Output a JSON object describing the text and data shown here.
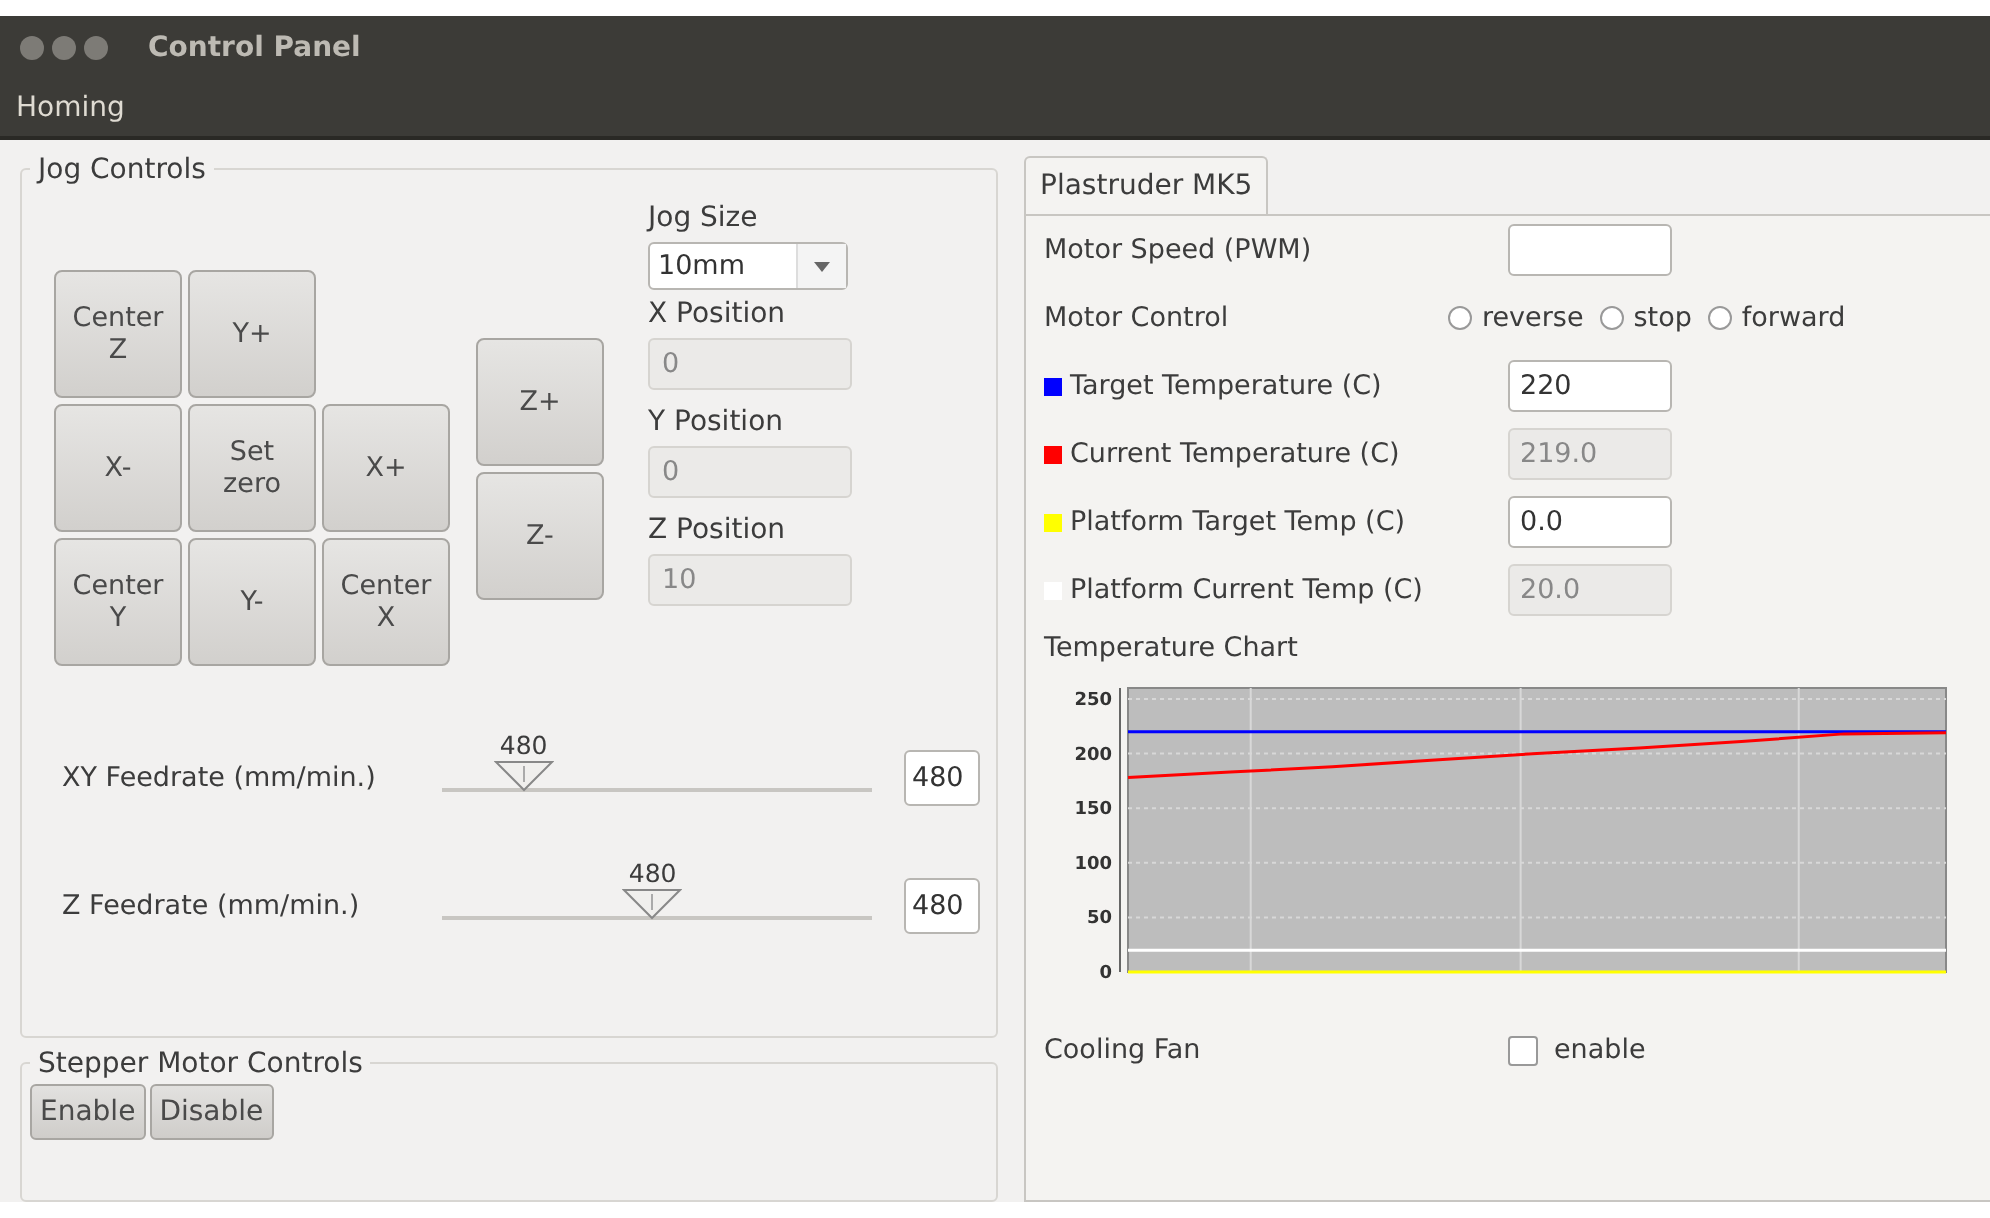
{
  "window": {
    "title": "Control Panel"
  },
  "menu": [
    "Homing"
  ],
  "jog_controls": {
    "title": "Jog Controls",
    "pad_rows": [
      {
        "buttons": [
          "Center Z",
          "Y+"
        ]
      },
      {
        "buttons": [
          "X-",
          "Set zero",
          "X+"
        ]
      },
      {
        "buttons": [
          "Center Y",
          "Y-",
          "Center X"
        ]
      }
    ],
    "z_buttons": [
      "Z+",
      "Z-"
    ],
    "jog_size": {
      "label": "Jog Size",
      "value": "10mm"
    },
    "positions": [
      {
        "label": "X Position",
        "value": "0"
      },
      {
        "label": "Y Position",
        "value": "0"
      },
      {
        "label": "Z Position",
        "value": "10"
      }
    ],
    "feedrates": [
      {
        "label": "XY Feedrate (mm/min.)",
        "reading": "480",
        "level": 0.19,
        "value": "480"
      },
      {
        "label": "Z Feedrate (mm/min.)",
        "reading": "480",
        "level": 0.49,
        "value": "480"
      }
    ]
  },
  "stepper": {
    "title": "Stepper Motor Controls",
    "buttons": [
      "Enable",
      "Disable"
    ]
  },
  "tabs": [
    {
      "label": "Plastruder MK5",
      "selected": true
    }
  ],
  "extruder": {
    "motor_speed": {
      "label": "Motor Speed (PWM)"
    },
    "motor_control": {
      "label": "Motor Control",
      "options": [
        {
          "label": "reverse",
          "selected": false
        },
        {
          "label": "stop",
          "selected": false
        },
        {
          "label": "forward",
          "selected": false
        }
      ]
    },
    "temps": [
      {
        "label": "Target Temperature (C)",
        "color": "#0000ff",
        "value": "220",
        "disabled": false
      },
      {
        "label": "Current Temperature (C)",
        "color": "#ff0000",
        "value": "219.0",
        "disabled": true
      },
      {
        "label": "Platform Target Temp (C)",
        "color": "#ffff00",
        "value": "0.0",
        "disabled": false
      },
      {
        "label": "Platform Current Temp (C)",
        "color": "#ffffff",
        "value": "20.0",
        "disabled": true
      }
    ],
    "chart_title": "Temperature Chart",
    "chart_data": {
      "type": "line",
      "grid": true,
      "ylim": [
        0,
        260
      ],
      "yticks": [
        0,
        50,
        100,
        150,
        200,
        250
      ],
      "series": [
        {
          "color": "#0000ff",
          "values": [
            220,
            220,
            220,
            220,
            220,
            220,
            220,
            220,
            220
          ]
        },
        {
          "color": "#ff0000",
          "values": [
            178,
            183,
            188,
            194,
            200,
            205,
            211,
            218,
            219
          ]
        },
        {
          "color": "#ffff00",
          "values": [
            0,
            0,
            0,
            0,
            0,
            0,
            0,
            0,
            0
          ]
        },
        {
          "color": "#ffffff",
          "values": [
            20,
            20,
            20,
            20,
            20,
            20,
            20,
            20,
            20
          ]
        }
      ]
    },
    "cooling_fan": {
      "label": "Cooling Fan",
      "option": "enable",
      "checked": false
    }
  }
}
